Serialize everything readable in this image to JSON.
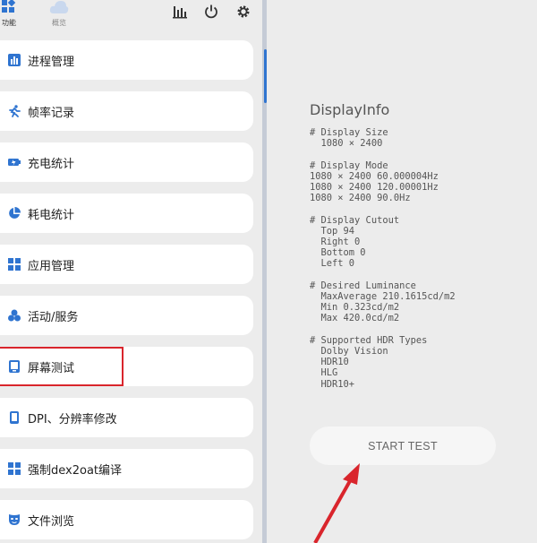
{
  "tabs": [
    {
      "label": "功能",
      "active": true
    },
    {
      "label": "概览",
      "active": false
    }
  ],
  "toolbar_icons": [
    "bar-chart-icon",
    "power-icon",
    "gear-icon"
  ],
  "menu": {
    "items": [
      {
        "label": "进程管理",
        "icon": "bar-chart-icon"
      },
      {
        "label": "帧率记录",
        "icon": "runner-icon"
      },
      {
        "label": "充电统计",
        "icon": "battery-icon"
      },
      {
        "label": "耗电统计",
        "icon": "pie-chart-icon"
      },
      {
        "label": "应用管理",
        "icon": "grid-icon"
      },
      {
        "label": "活动/服务",
        "icon": "circles-icon"
      },
      {
        "label": "屏幕测试",
        "icon": "screen-icon"
      },
      {
        "label": "DPI、分辨率修改",
        "icon": "phone-icon"
      },
      {
        "label": "强制dex2oat编译",
        "icon": "grid-icon"
      },
      {
        "label": "文件浏览",
        "icon": "mask-icon"
      }
    ]
  },
  "display_info": {
    "title": "DisplayInfo",
    "sections": [
      {
        "header": "# Display Size",
        "lines": [
          "  1080 × 2400"
        ]
      },
      {
        "header": "# Display Mode",
        "lines": [
          "1080 × 2400 60.000004Hz",
          "1080 × 2400 120.00001Hz",
          "1080 × 2400 90.0Hz"
        ]
      },
      {
        "header": "# Display Cutout",
        "lines": [
          "  Top 94",
          "  Right 0",
          "  Bottom 0",
          "  Left 0"
        ]
      },
      {
        "header": "# Desired Luminance",
        "lines": [
          "  MaxAverage 210.1615cd/m2",
          "  Min 0.323cd/m2",
          "  Max 420.0cd/m2"
        ]
      },
      {
        "header": "# Supported HDR Types",
        "lines": [
          "  Dolby Vision",
          "  HDR10",
          "  HLG",
          "  HDR10+"
        ]
      }
    ]
  },
  "start_button": {
    "label": "START TEST"
  },
  "colors": {
    "accent": "#2f74d0",
    "highlight": "#d9252c",
    "arrow": "#d9252c"
  }
}
